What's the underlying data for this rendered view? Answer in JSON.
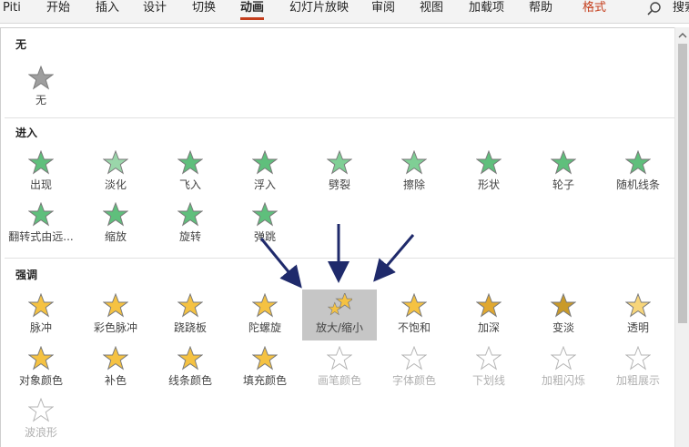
{
  "ribbon": {
    "tabs": [
      "Piti",
      "开始",
      "插入",
      "设计",
      "切换",
      "动画",
      "幻灯片放映",
      "审阅",
      "视图",
      "加载项",
      "帮助",
      "格式"
    ],
    "active_tab": "动画",
    "search_label": "搜索"
  },
  "gallery": {
    "sections": [
      {
        "title": "无",
        "items": [
          {
            "label": "无",
            "icon": "star-none-icon",
            "color": "#9e9e9e",
            "state": "normal"
          }
        ]
      },
      {
        "title": "进入",
        "items": [
          {
            "label": "出现",
            "icon": "star-appear-icon",
            "color": "#5fbf7c",
            "state": "normal"
          },
          {
            "label": "淡化",
            "icon": "star-fade-icon",
            "color": "#9ad6aa",
            "state": "normal"
          },
          {
            "label": "飞入",
            "icon": "star-fly-in-icon",
            "color": "#5fbf7c",
            "state": "normal"
          },
          {
            "label": "浮入",
            "icon": "star-float-in-icon",
            "color": "#5fbf7c",
            "state": "normal"
          },
          {
            "label": "劈裂",
            "icon": "star-split-icon",
            "color": "#7fcf95",
            "state": "normal"
          },
          {
            "label": "擦除",
            "icon": "star-wipe-icon",
            "color": "#7fcf95",
            "state": "normal"
          },
          {
            "label": "形状",
            "icon": "star-shape-icon",
            "color": "#5fbf7c",
            "state": "normal"
          },
          {
            "label": "轮子",
            "icon": "star-wheel-icon",
            "color": "#5fbf7c",
            "state": "normal"
          },
          {
            "label": "随机线条",
            "icon": "star-random-bars-icon",
            "color": "#5fbf7c",
            "state": "normal"
          },
          {
            "label": "翻转式由远...",
            "icon": "star-grow-turn-icon",
            "color": "#5fbf7c",
            "state": "normal"
          },
          {
            "label": "缩放",
            "icon": "star-zoom-icon",
            "color": "#5fbf7c",
            "state": "normal"
          },
          {
            "label": "旋转",
            "icon": "star-swivel-icon",
            "color": "#5fbf7c",
            "state": "normal"
          },
          {
            "label": "弹跳",
            "icon": "star-bounce-icon",
            "color": "#5fbf7c",
            "state": "normal"
          }
        ]
      },
      {
        "title": "强调",
        "items": [
          {
            "label": "脉冲",
            "icon": "star-pulse-icon",
            "color": "#f5c242",
            "state": "normal"
          },
          {
            "label": "彩色脉冲",
            "icon": "star-color-pulse-icon",
            "color": "#f5c242",
            "state": "normal"
          },
          {
            "label": "跷跷板",
            "icon": "star-teeter-icon",
            "color": "#f5c242",
            "state": "normal"
          },
          {
            "label": "陀螺旋",
            "icon": "star-spin-icon",
            "color": "#f5c242",
            "state": "normal"
          },
          {
            "label": "放大/缩小",
            "icon": "star-grow-shrink-icon",
            "color": "#f5c242",
            "state": "selected"
          },
          {
            "label": "不饱和",
            "icon": "star-desaturate-icon",
            "color": "#f5c242",
            "state": "normal"
          },
          {
            "label": "加深",
            "icon": "star-darken-icon",
            "color": "#e0a830",
            "state": "normal"
          },
          {
            "label": "变淡",
            "icon": "star-lighten-icon",
            "color": "#c99a2a",
            "state": "normal"
          },
          {
            "label": "透明",
            "icon": "star-transparency-icon",
            "color": "#f7d57a",
            "state": "normal"
          },
          {
            "label": "对象颜色",
            "icon": "star-object-color-icon",
            "color": "#f5c242",
            "state": "normal"
          },
          {
            "label": "补色",
            "icon": "star-complementary-color-icon",
            "color": "#f5c242",
            "state": "normal"
          },
          {
            "label": "线条颜色",
            "icon": "star-line-color-icon",
            "color": "#f5c242",
            "state": "normal"
          },
          {
            "label": "填充颜色",
            "icon": "star-fill-color-icon",
            "color": "#f5c242",
            "state": "normal"
          },
          {
            "label": "画笔颜色",
            "icon": "star-brush-color-icon",
            "color": "#c8c8c8",
            "state": "disabled"
          },
          {
            "label": "字体颜色",
            "icon": "star-font-color-icon",
            "color": "#c8c8c8",
            "state": "disabled"
          },
          {
            "label": "下划线",
            "icon": "star-underline-icon",
            "color": "#c8c8c8",
            "state": "disabled"
          },
          {
            "label": "加粗闪烁",
            "icon": "star-bold-flash-icon",
            "color": "#c8c8c8",
            "state": "disabled"
          },
          {
            "label": "加粗展示",
            "icon": "star-bold-reveal-icon",
            "color": "#c8c8c8",
            "state": "disabled"
          },
          {
            "label": "波浪形",
            "icon": "star-wave-icon",
            "color": "#c8c8c8",
            "state": "disabled"
          }
        ]
      }
    ]
  },
  "annotation": {
    "arrow_color": "#1f2a6b",
    "arrow_target": "放大/缩小"
  },
  "colors": {
    "accent": "#c43e1c",
    "selected_bg": "#c6c6c6"
  }
}
